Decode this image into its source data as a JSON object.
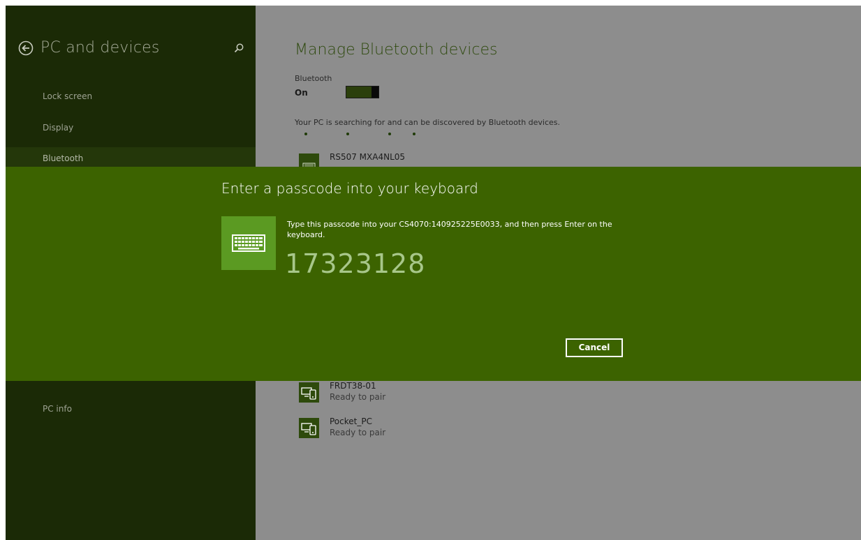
{
  "sidebar": {
    "title": "PC and devices",
    "back_icon": "back-arrow-icon",
    "search_icon": "search-icon",
    "items": [
      {
        "label": "Lock screen"
      },
      {
        "label": "Display"
      },
      {
        "label": "Bluetooth",
        "selected": true
      },
      {
        "label": "PC info"
      }
    ]
  },
  "main": {
    "title": "Manage Bluetooth devices",
    "bluetooth_label": "Bluetooth",
    "bluetooth_state": "On",
    "search_status": "Your PC is searching for and can be discovered by Bluetooth devices.",
    "devices": [
      {
        "name": "RS507 MXA4NL05",
        "status": "",
        "icon": "keyboard-device-icon"
      },
      {
        "name": "FRDT38-01",
        "status": "Ready to pair",
        "icon": "phone-pc-device-icon"
      },
      {
        "name": "Pocket_PC",
        "status": "Ready to pair",
        "icon": "phone-pc-device-icon"
      }
    ]
  },
  "dialog": {
    "title": "Enter a passcode into your keyboard",
    "instruction": "Type this passcode into your CS4070:140925225E0033, and then press Enter on the keyboard.",
    "passcode": "17323128",
    "cancel_label": "Cancel",
    "icon": "keyboard-icon"
  },
  "colors": {
    "sidebar_bg": "#1b2a06",
    "main_bg": "#8d8d8d",
    "dialog_bg": "#3c6300",
    "accent": "#5b9a22"
  }
}
